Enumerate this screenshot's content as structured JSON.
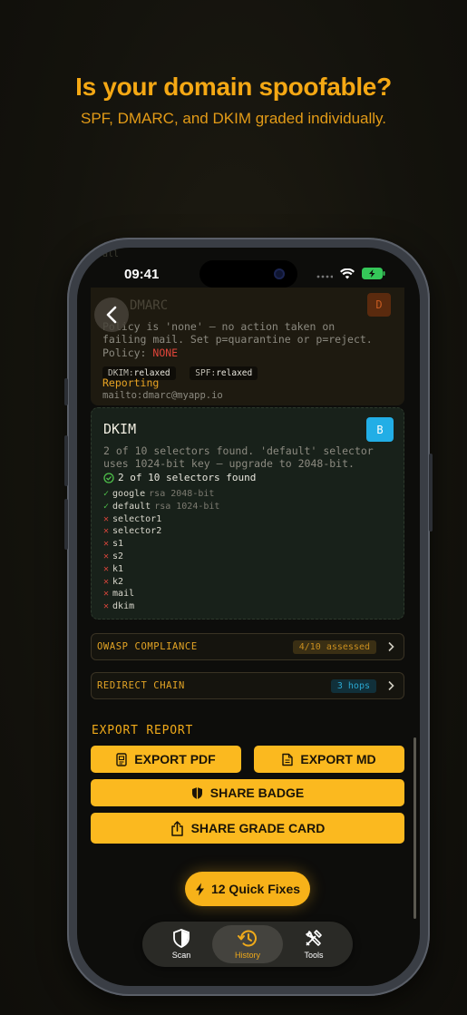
{
  "marketing": {
    "headline": "Is your domain spoofable?",
    "subheadline": "SPF, DMARC, and DKIM graded individually."
  },
  "status_bar": {
    "time": "09:41",
    "icons": [
      "signal-dots-icon",
      "wifi-icon",
      "battery-charging-icon"
    ]
  },
  "ghost_text": {
    "top": "all",
    "tools": "EXPORT PDF PDF"
  },
  "dmarc": {
    "title": "DMARC",
    "grade": "D",
    "grade_color": "#c55a21",
    "description": "Policy is 'none' — no action taken on failing mail. Set p=quarantine or p=reject.",
    "policy_label": "Policy:",
    "policy_value": "NONE",
    "policy_color": "#e0453a",
    "pills": [
      {
        "name": "DKIM:",
        "value": "relaxed"
      },
      {
        "name": "SPF:",
        "value": "relaxed"
      }
    ],
    "reporting_label": "Reporting",
    "reporting_value": "mailto:dmarc@myapp.io"
  },
  "dkim": {
    "title": "DKIM",
    "grade": "B",
    "grade_color": "#22aee6",
    "description": "2 of 10 selectors found. 'default' selector uses 1024-bit key — upgrade to 2048-bit.",
    "summary": "2 of 10 selectors found",
    "selectors": [
      {
        "status": "found",
        "name": "google",
        "meta": "rsa 2048-bit"
      },
      {
        "status": "found",
        "name": "default",
        "meta": "rsa 1024-bit"
      },
      {
        "status": "missing",
        "name": "selector1",
        "meta": ""
      },
      {
        "status": "missing",
        "name": "selector2",
        "meta": ""
      },
      {
        "status": "missing",
        "name": "s1",
        "meta": ""
      },
      {
        "status": "missing",
        "name": "s2",
        "meta": ""
      },
      {
        "status": "missing",
        "name": "k1",
        "meta": ""
      },
      {
        "status": "missing",
        "name": "k2",
        "meta": ""
      },
      {
        "status": "missing",
        "name": "mail",
        "meta": ""
      },
      {
        "status": "missing",
        "name": "dkim",
        "meta": ""
      }
    ]
  },
  "rows": {
    "owasp": {
      "label": "OWASP COMPLIANCE",
      "badge": "4/10 assessed"
    },
    "redirect": {
      "label": "REDIRECT CHAIN",
      "badge": "3 hops"
    }
  },
  "export": {
    "title": "EXPORT REPORT",
    "pdf": "EXPORT PDF",
    "md": "EXPORT MD",
    "badge": "SHARE BADGE",
    "grade_card": "SHARE GRADE CARD"
  },
  "quick_fixes": "12 Quick Fixes",
  "tabs": [
    {
      "label": "Scan",
      "icon": "shield-icon"
    },
    {
      "label": "History",
      "icon": "history-icon"
    },
    {
      "label": "Tools",
      "icon": "tools-icon"
    }
  ],
  "colors": {
    "accent": "#fbb91f",
    "found": "#4fc14b",
    "missing": "#d9453b"
  }
}
